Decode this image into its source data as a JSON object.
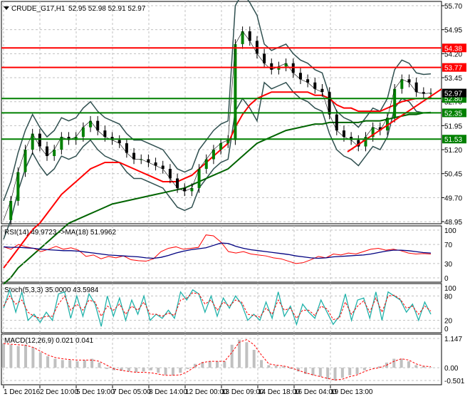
{
  "header": {
    "symbol": "CRUDE_G17,H1",
    "ohlc": "52.95 52.98 52.91 52.97"
  },
  "colors": {
    "bull": "#008000",
    "bear": "#000000",
    "level_red": "#ff0000",
    "level_green": "#008000",
    "ma_fast": "#ff0000",
    "ma_slow": "#006400",
    "bands": "#2f4f4f",
    "rsi": "#ff0000",
    "rsi_ma": "#000080",
    "stoch_main": "#20b2aa",
    "stoch_signal": "#ff0000",
    "macd_hist": "#c0c0c0",
    "macd_signal": "#ff0000"
  },
  "chart_data": [
    {
      "type": "line",
      "name": "price",
      "title": "CRUDE_G17,H1",
      "ylim": [
        48.95,
        55.7
      ],
      "yticks": [
        "55.70",
        "54.95",
        "54.20",
        "53.45",
        "52.70",
        "51.95",
        "51.20",
        "50.45",
        "49.70",
        "48.95"
      ],
      "current": "52.97",
      "levels": [
        {
          "label": "54.38",
          "value": 54.38,
          "color": "red"
        },
        {
          "label": "53.77",
          "value": 53.77,
          "color": "red"
        },
        {
          "label": "52.80",
          "value": 52.8,
          "color": "green"
        },
        {
          "label": "52.35",
          "value": 52.35,
          "color": "green"
        },
        {
          "label": "51.53",
          "value": 51.53,
          "color": "green"
        }
      ],
      "close": [
        49.0,
        49.6,
        50.5,
        51.2,
        51.7,
        51.3,
        51.0,
        51.2,
        51.6,
        51.5,
        51.6,
        51.9,
        52.1,
        51.8,
        51.6,
        51.5,
        51.4,
        51.1,
        50.9,
        50.9,
        50.8,
        50.7,
        50.6,
        50.3,
        50.0,
        49.9,
        50.0,
        50.6,
        50.9,
        51.2,
        51.4,
        51.5,
        54.5,
        54.9,
        54.6,
        54.2,
        53.9,
        53.7,
        53.8,
        53.9,
        53.6,
        53.4,
        53.3,
        53.1,
        53.0,
        52.3,
        51.8,
        51.6,
        51.5,
        51.3,
        51.6,
        51.9,
        51.8,
        52.2,
        53.1,
        53.4,
        53.3,
        53.0,
        52.95,
        52.97
      ],
      "ma_fast": [
        47.5,
        47.8,
        48.1,
        48.4,
        48.7,
        48.9,
        49.2,
        49.5,
        49.8,
        50.0,
        50.2,
        50.4,
        50.6,
        50.7,
        50.8,
        50.8,
        50.8,
        50.7,
        50.6,
        50.5,
        50.4,
        50.3,
        50.2,
        50.2,
        50.2,
        50.3,
        50.4,
        50.6,
        50.8,
        51.0,
        51.2,
        51.4,
        51.9,
        52.3,
        52.6,
        52.8,
        52.9,
        53.0,
        53.0,
        53.0,
        53.0,
        53.0,
        53.0,
        52.9,
        52.9,
        52.8,
        52.6,
        52.5,
        52.5,
        52.4,
        52.4,
        52.4,
        52.4,
        52.5,
        52.6,
        52.7,
        52.75,
        52.8,
        52.8,
        52.8
      ],
      "ma_slow": [
        47.0,
        47.2,
        47.5,
        47.7,
        47.9,
        48.1,
        48.3,
        48.5,
        48.7,
        48.9,
        49.0,
        49.1,
        49.2,
        49.3,
        49.4,
        49.5,
        49.55,
        49.6,
        49.65,
        49.7,
        49.75,
        49.8,
        49.85,
        49.9,
        49.95,
        50.0,
        50.1,
        50.2,
        50.3,
        50.4,
        50.5,
        50.6,
        50.8,
        51.0,
        51.2,
        51.4,
        51.5,
        51.6,
        51.7,
        51.8,
        51.85,
        51.9,
        51.95,
        52.0,
        52.0,
        52.05,
        52.05,
        52.05,
        52.05,
        52.05,
        52.1,
        52.1,
        52.1,
        52.15,
        52.2,
        52.25,
        52.3,
        52.3,
        52.35,
        52.35
      ]
    },
    {
      "type": "line",
      "name": "rsi",
      "title": "RSI(14) 49.9723  ->MA(18) 51.9962",
      "ylim": [
        0,
        100
      ],
      "yticks": [
        "100",
        "70",
        "30",
        "0"
      ],
      "rsi": [
        65,
        60,
        70,
        65,
        62,
        55,
        60,
        66,
        60,
        63,
        58,
        45,
        48,
        40,
        45,
        42,
        46,
        38,
        36,
        35,
        40,
        55,
        62,
        65,
        60,
        62,
        64,
        90,
        88,
        75,
        55,
        52,
        55,
        50,
        48,
        46,
        42,
        40,
        35,
        30,
        32,
        38,
        45,
        42,
        50,
        48,
        52,
        50,
        55,
        60,
        62,
        58,
        60,
        57,
        52,
        50,
        51,
        50
      ],
      "ma": [
        65,
        64,
        64,
        63,
        62,
        60,
        59,
        58,
        57,
        57,
        56,
        54,
        52,
        50,
        48,
        47,
        46,
        45,
        44,
        42,
        41,
        43,
        47,
        52,
        56,
        59,
        61,
        63,
        68,
        73,
        72,
        66,
        62,
        59,
        57,
        55,
        53,
        51,
        49,
        46,
        44,
        42,
        41,
        42,
        44,
        45,
        46,
        47,
        48,
        50,
        53,
        56,
        58,
        58,
        57,
        55,
        53,
        52
      ]
    },
    {
      "type": "line",
      "name": "stochastic",
      "title": "Stoch(5,3,3) 35.0000 43.5984",
      "ylim": [
        0,
        100
      ],
      "yticks": [
        "100",
        "80",
        "20",
        "0"
      ],
      "main": [
        50,
        95,
        40,
        90,
        20,
        35,
        15,
        40,
        20,
        85,
        90,
        25,
        80,
        30,
        85,
        60,
        5,
        80,
        30,
        75,
        20,
        70,
        35,
        80,
        20,
        35,
        25,
        45,
        25,
        90,
        70,
        95,
        85,
        40,
        80,
        30,
        75,
        50,
        80,
        60,
        20,
        35,
        20,
        65,
        25,
        90,
        30,
        55,
        10,
        60,
        40,
        25,
        70,
        40,
        10,
        30,
        85,
        20,
        70,
        75,
        25,
        90,
        20,
        90,
        80,
        70,
        40,
        60,
        20,
        65,
        35
      ],
      "signal": [
        55,
        80,
        60,
        70,
        40,
        30,
        25,
        30,
        30,
        60,
        80,
        45,
        60,
        45,
        70,
        65,
        30,
        55,
        45,
        60,
        35,
        55,
        45,
        65,
        35,
        35,
        30,
        38,
        32,
        70,
        75,
        88,
        85,
        60,
        70,
        45,
        65,
        55,
        70,
        65,
        35,
        32,
        28,
        50,
        35,
        70,
        45,
        50,
        25,
        45,
        45,
        32,
        55,
        48,
        22,
        25,
        65,
        35,
        55,
        68,
        40,
        75,
        40,
        80,
        82,
        72,
        50,
        55,
        35,
        55,
        43
      ]
    },
    {
      "type": "bar",
      "name": "macd",
      "title": "MACD(12,26,9) 0.021 0.041",
      "ylim": [
        -0.501,
        1.147
      ],
      "yticks": [
        "1.147",
        "0.00",
        "-0.501"
      ],
      "hist": [
        0.95,
        0.9,
        0.85,
        0.9,
        0.8,
        0.6,
        0.45,
        0.35,
        0.3,
        0.3,
        0.25,
        0.3,
        0.35,
        0.2,
        -0.05,
        -0.1,
        -0.12,
        -0.15,
        -0.18,
        -0.15,
        -0.1,
        -0.2,
        -0.28,
        -0.3,
        -0.2,
        -0.05,
        0.15,
        0.22,
        0.25,
        0.25,
        0.25,
        0.9,
        1.1,
        1.0,
        0.7,
        0.3,
        0.1,
        0.08,
        0.05,
        -0.05,
        -0.15,
        -0.25,
        -0.3,
        -0.35,
        -0.45,
        -0.5,
        -0.4,
        -0.3,
        -0.25,
        -0.1,
        0.0,
        0.05,
        0.2,
        0.35,
        0.35,
        0.25,
        0.1,
        0.05,
        0.02
      ],
      "signal": [
        0.95,
        0.92,
        0.9,
        0.88,
        0.8,
        0.65,
        0.5,
        0.4,
        0.35,
        0.32,
        0.3,
        0.3,
        0.3,
        0.25,
        0.1,
        -0.05,
        -0.1,
        -0.15,
        -0.18,
        -0.18,
        -0.2,
        -0.25,
        -0.3,
        -0.3,
        -0.28,
        -0.15,
        0.05,
        0.2,
        0.25,
        0.25,
        0.25,
        0.6,
        1.0,
        1.1,
        0.9,
        0.5,
        0.15,
        0.1,
        0.07,
        0.0,
        -0.1,
        -0.2,
        -0.28,
        -0.35,
        -0.42,
        -0.48,
        -0.45,
        -0.35,
        -0.28,
        -0.15,
        -0.05,
        0.0,
        0.1,
        0.25,
        0.35,
        0.3,
        0.15,
        0.06,
        0.04
      ]
    }
  ],
  "xaxis": {
    "labels": [
      "1 Dec 2016",
      "2 Dec 10:00",
      "5 Dec 19:00",
      "7 Dec 05:00",
      "8 Dec 14:00",
      "12 Dec 00:00",
      "13 Dec 09:00",
      "14 Dec 18:00",
      "16 Dec 04:00",
      "19 Dec 13:00"
    ]
  }
}
